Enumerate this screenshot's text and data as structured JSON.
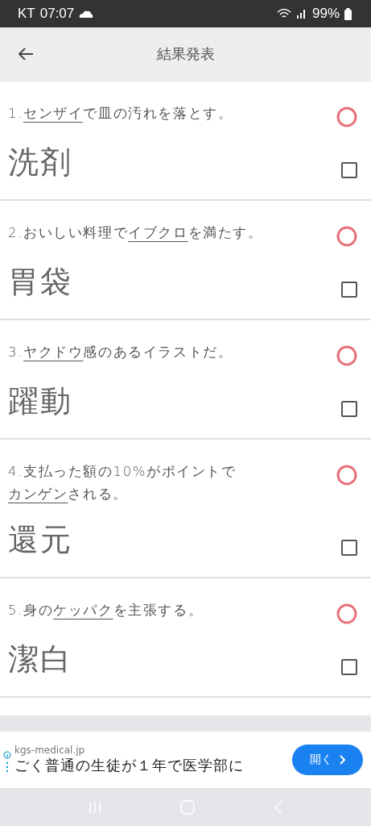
{
  "status_bar": {
    "carrier": "KT",
    "time": "07:07",
    "battery": "99%"
  },
  "app_bar": {
    "title": "結果発表"
  },
  "questions": [
    {
      "number": "1.",
      "underlined": "センザイ",
      "after": "で皿の汚れを落とす。",
      "answer": "洗剤",
      "correct": true,
      "checked": false
    },
    {
      "number": "2.",
      "before": "おいしい料理で",
      "underlined": "イブクロ",
      "after": "を満たす。",
      "answer": "胃袋",
      "correct": true,
      "checked": false
    },
    {
      "number": "3.",
      "underlined": "ヤクドウ",
      "after": "感のあるイラストだ。",
      "answer": "躍動",
      "correct": true,
      "checked": false
    },
    {
      "number": "4.",
      "before": "支払った額の10%がポイントで",
      "underlined": "カンゲン",
      "after": "される。",
      "answer": "還元",
      "correct": true,
      "checked": false
    },
    {
      "number": "5.",
      "before": "身の",
      "underlined": "ケッパク",
      "after": "を主張する。",
      "answer": "潔白",
      "correct": true,
      "checked": false
    }
  ],
  "ad": {
    "domain": "kgs-medical.jp",
    "headline": "ごく普通の生徒が１年で医学部に",
    "button": "開く"
  }
}
